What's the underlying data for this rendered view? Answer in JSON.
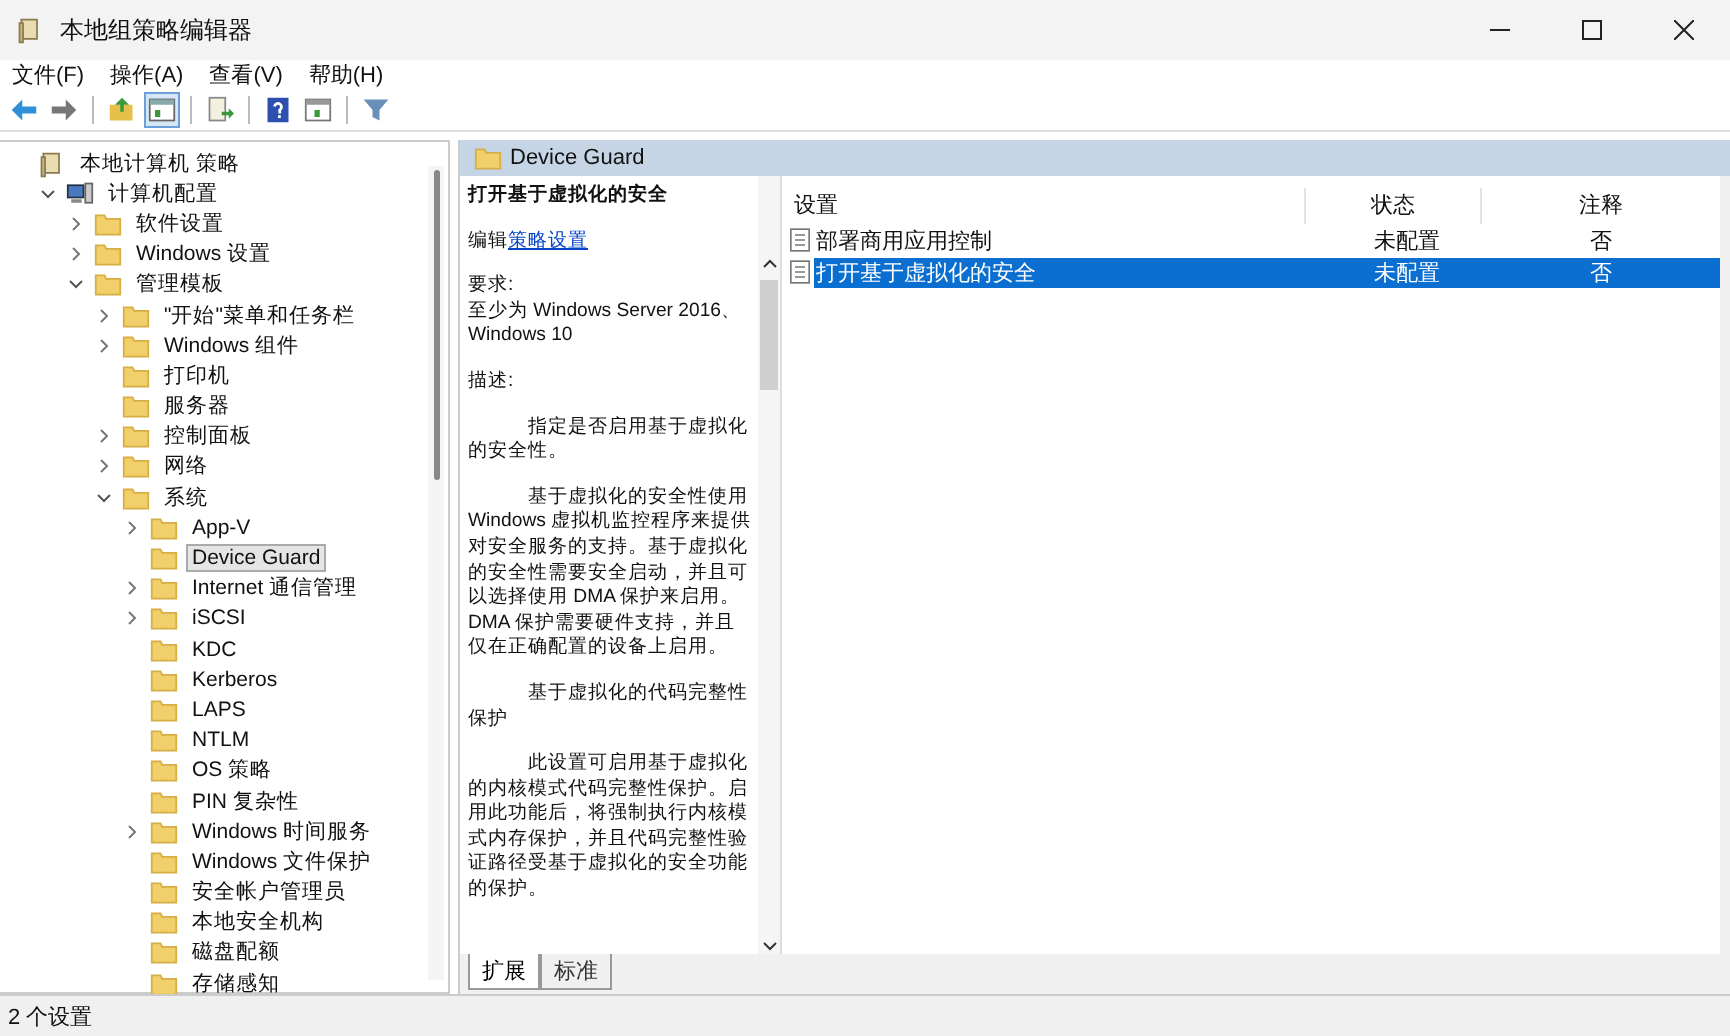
{
  "window": {
    "title": "本地组策略编辑器"
  },
  "menu": [
    "文件(F)",
    "操作(A)",
    "查看(V)",
    "帮助(H)"
  ],
  "toolbar": [
    {
      "kind": "back",
      "pressed": false
    },
    {
      "kind": "forward",
      "pressed": false
    },
    {
      "kind": "sep"
    },
    {
      "kind": "up",
      "pressed": false
    },
    {
      "kind": "tree",
      "pressed": true
    },
    {
      "kind": "sep"
    },
    {
      "kind": "export",
      "pressed": false
    },
    {
      "kind": "sep"
    },
    {
      "kind": "help",
      "pressed": false
    },
    {
      "kind": "pane",
      "pressed": false
    },
    {
      "kind": "sep"
    },
    {
      "kind": "filter",
      "pressed": false
    }
  ],
  "tree": [
    {
      "label": "本地计算机 策略",
      "kind": "policy",
      "selected": false,
      "children": [
        {
          "label": "计算机配置",
          "kind": "computer",
          "expanded": true,
          "selected": false,
          "children": [
            {
              "label": "软件设置",
              "kind": "folder",
              "expanded": false,
              "selected": false
            },
            {
              "label": "Windows 设置",
              "kind": "folder",
              "expanded": false,
              "selected": false
            },
            {
              "label": "管理模板",
              "kind": "folder",
              "expanded": true,
              "selected": false,
              "children": [
                {
                  "label": "\"开始\"菜单和任务栏",
                  "kind": "folder",
                  "expanded": false,
                  "selected": false
                },
                {
                  "label": "Windows 组件",
                  "kind": "folder",
                  "expanded": false,
                  "selected": false
                },
                {
                  "label": "打印机",
                  "kind": "folder",
                  "selected": false
                },
                {
                  "label": "服务器",
                  "kind": "folder",
                  "selected": false
                },
                {
                  "label": "控制面板",
                  "kind": "folder",
                  "expanded": false,
                  "selected": false
                },
                {
                  "label": "网络",
                  "kind": "folder",
                  "expanded": false,
                  "selected": false
                },
                {
                  "label": "系统",
                  "kind": "folder",
                  "expanded": true,
                  "selected": false,
                  "children": [
                    {
                      "label": "App-V",
                      "kind": "folder",
                      "expanded": false,
                      "selected": false
                    },
                    {
                      "label": "Device Guard",
                      "kind": "folder",
                      "selected": true
                    },
                    {
                      "label": "Internet 通信管理",
                      "kind": "folder",
                      "expanded": false,
                      "selected": false
                    },
                    {
                      "label": "iSCSI",
                      "kind": "folder",
                      "expanded": false,
                      "selected": false
                    },
                    {
                      "label": "KDC",
                      "kind": "folder",
                      "selected": false
                    },
                    {
                      "label": "Kerberos",
                      "kind": "folder",
                      "selected": false
                    },
                    {
                      "label": "LAPS",
                      "kind": "folder",
                      "selected": false
                    },
                    {
                      "label": "NTLM",
                      "kind": "folder",
                      "selected": false
                    },
                    {
                      "label": "OS 策略",
                      "kind": "folder",
                      "selected": false
                    },
                    {
                      "label": "PIN 复杂性",
                      "kind": "folder",
                      "selected": false
                    },
                    {
                      "label": "Windows 时间服务",
                      "kind": "folder",
                      "expanded": false,
                      "selected": false
                    },
                    {
                      "label": "Windows 文件保护",
                      "kind": "folder",
                      "selected": false
                    },
                    {
                      "label": "安全帐户管理员",
                      "kind": "folder",
                      "selected": false
                    },
                    {
                      "label": "本地安全机构",
                      "kind": "folder",
                      "selected": false
                    },
                    {
                      "label": "磁盘配额",
                      "kind": "folder",
                      "selected": false
                    },
                    {
                      "label": "存储感知",
                      "kind": "folder",
                      "selected": false
                    }
                  ]
                }
              ]
            }
          ]
        }
      ]
    }
  ],
  "header": {
    "title": "Device Guard"
  },
  "description": {
    "title": "打开基于虚拟化的安全",
    "edit_prefix": "编辑",
    "edit_link": "策略设置",
    "requirements_label": "要求:",
    "requirements": "至少为 Windows Server 2016、Windows 10",
    "description_label": "描述:",
    "paragraphs": [
      "指定是否启用基于虚拟化的安全性。",
      "基于虚拟化的安全性使用 Windows 虚拟机监控程序来提供对安全服务的支持。基于虚拟化的安全性需要安全启动，并且可以选择使用 DMA 保护来启用。DMA 保护需要硬件支持，并且仅在正确配置的设备上启用。",
      "基于虚拟化的代码完整性保护",
      "此设置可启用基于虚拟化的内核模式代码完整性保护。启用此功能后，将强制执行内核模式内存保护，并且代码完整性验证路径受基于虚拟化的安全功能的保护。"
    ]
  },
  "tabs": [
    {
      "label": "扩展",
      "selected": true
    },
    {
      "label": "标准",
      "selected": false
    }
  ],
  "table": {
    "columns": [
      "设置",
      "状态",
      "注释"
    ],
    "rows": [
      {
        "cells": [
          "部署商用应用控制",
          "未配置",
          "否"
        ],
        "selected": false
      },
      {
        "cells": [
          "打开基于虚拟化的安全",
          "未配置",
          "否"
        ],
        "selected": true
      }
    ]
  },
  "status_bar": "2 个设置"
}
